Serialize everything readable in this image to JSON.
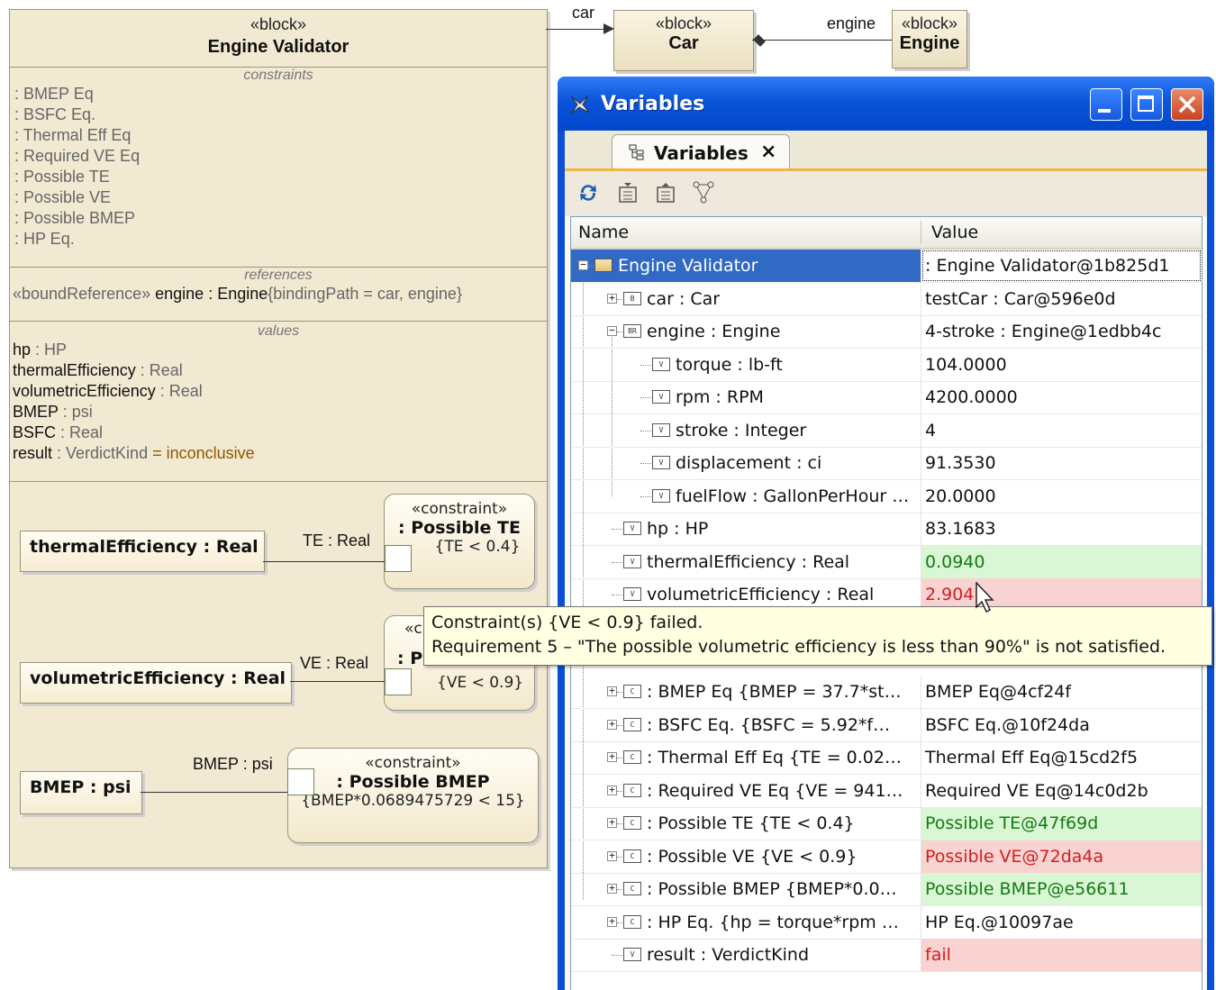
{
  "diagram": {
    "engine_validator": {
      "stereotype": "«block»",
      "name": "Engine Validator",
      "constraints_title": "constraints",
      "constraints": [
        ": BMEP Eq",
        ": BSFC Eq.",
        ": Thermal Eff Eq",
        ": Required VE Eq",
        ": Possible TE",
        ": Possible VE",
        ": Possible BMEP",
        ": HP Eq."
      ],
      "references_title": "references",
      "reference": {
        "stereotype": "«boundReference»",
        "name": "engine",
        "type": " : Engine",
        "binding": "{bindingPath = car, engine}"
      },
      "values_title": "values",
      "values": [
        {
          "name": "hp",
          "type": " : HP"
        },
        {
          "name": "thermalEfficiency",
          "type": " : Real"
        },
        {
          "name": "volumetricEfficiency",
          "type": " : Real"
        },
        {
          "name": "BMEP",
          "type": " : psi"
        },
        {
          "name": "BSFC",
          "type": " : Real"
        }
      ],
      "result": {
        "name": "result",
        "type": " : VerdictKind",
        "eq": " = ",
        "value": "inconclusive"
      }
    },
    "parts": {
      "thermal": "thermalEfficiency : Real",
      "volumetric": "volumetricEfficiency : Real",
      "bmep": "BMEP : psi"
    },
    "constraint_props": {
      "te": {
        "stereotype": "«constraint»",
        "name": ": Possible TE",
        "expr": "{TE < 0.4}",
        "port_label": "TE : Real"
      },
      "ve": {
        "stereotype": "«c",
        "name": ": P",
        "expr": "{VE < 0.9}",
        "port_label": "VE : Real"
      },
      "bmep": {
        "stereotype": "«constraint»",
        "name": ": Possible BMEP",
        "expr": "{BMEP*0.0689475729 < 15}",
        "port_label": "BMEP : psi"
      }
    },
    "car_block": {
      "stereotype": "«block»",
      "name": "Car",
      "assoc_label": "car"
    },
    "engine_block": {
      "stereotype": "«block»",
      "name": "Engine",
      "assoc_label": "engine"
    }
  },
  "window": {
    "title": "Variables",
    "tab_label": "Variables",
    "columns": {
      "name": "Name",
      "value": "Value"
    },
    "rows": [
      {
        "name": "Engine Validator",
        "value": ": Engine Validator@1b825d1",
        "status": "selected",
        "icon": "block-icon"
      },
      {
        "name": "car : Car",
        "value": "testCar : Car@596e0d",
        "status": "",
        "icon": "part-icon"
      },
      {
        "name": "engine : Engine",
        "value": "4-stroke : Engine@1edbb4c",
        "status": "",
        "icon": "reference-icon"
      },
      {
        "name": "torque : lb-ft",
        "value": "104.0000",
        "status": "",
        "icon": "value-icon"
      },
      {
        "name": "rpm : RPM",
        "value": "4200.0000",
        "status": "",
        "icon": "value-icon"
      },
      {
        "name": "stroke : Integer",
        "value": "4",
        "status": "",
        "icon": "value-icon"
      },
      {
        "name": "displacement : ci",
        "value": "91.3530",
        "status": "",
        "icon": "value-icon"
      },
      {
        "name": "fuelFlow : GallonPerHour …",
        "value": "20.0000",
        "status": "",
        "icon": "value-icon"
      },
      {
        "name": "hp : HP",
        "value": "83.1683",
        "status": "",
        "icon": "value-icon"
      },
      {
        "name": "thermalEfficiency : Real",
        "value": "0.0940",
        "status": "pass",
        "icon": "value-icon"
      },
      {
        "name": "volumetricEfficiency : Real",
        "value": "2.904",
        "status": "fail",
        "icon": "value-icon"
      },
      {
        "name": ": BMEP Eq {BMEP = 37.7*st…",
        "value": "BMEP Eq@4cf24f",
        "status": "",
        "icon": "constraint-icon"
      },
      {
        "name": ": BSFC Eq. {BSFC = 5.92*f…",
        "value": "BSFC Eq.@10f24da",
        "status": "",
        "icon": "constraint-icon"
      },
      {
        "name": ": Thermal Eff Eq {TE = 0.02…",
        "value": "Thermal Eff Eq@15cd2f5",
        "status": "",
        "icon": "constraint-icon"
      },
      {
        "name": ": Required VE Eq {VE = 941…",
        "value": "Required VE Eq@14c0d2b",
        "status": "",
        "icon": "constraint-icon"
      },
      {
        "name": ": Possible TE {TE < 0.4}",
        "value": "Possible TE@47f69d",
        "status": "pass",
        "icon": "constraint-icon"
      },
      {
        "name": ": Possible VE {VE < 0.9}",
        "value": "Possible VE@72da4a",
        "status": "fail",
        "icon": "constraint-icon"
      },
      {
        "name": ": Possible BMEP {BMEP*0.0…",
        "value": "Possible BMEP@e56611",
        "status": "pass",
        "icon": "constraint-icon"
      },
      {
        "name": ": HP Eq. {hp = torque*rpm …",
        "value": "HP Eq.@10097ae",
        "status": "",
        "icon": "constraint-icon"
      },
      {
        "name": "result : VerdictKind",
        "value": "fail",
        "status": "fail",
        "icon": "value-icon"
      }
    ],
    "tooltip": {
      "line1": "Constraint(s) {VE < 0.9} failed.",
      "line2": "Requirement 5 – \"The possible volumetric efficiency is less than 90%\" is not satisfied."
    }
  },
  "colors": {
    "pass_bg": "#d9f7d4",
    "fail_bg": "#f9d2d2",
    "selection": "#316ac5",
    "titlebar": "#0b55d9"
  }
}
